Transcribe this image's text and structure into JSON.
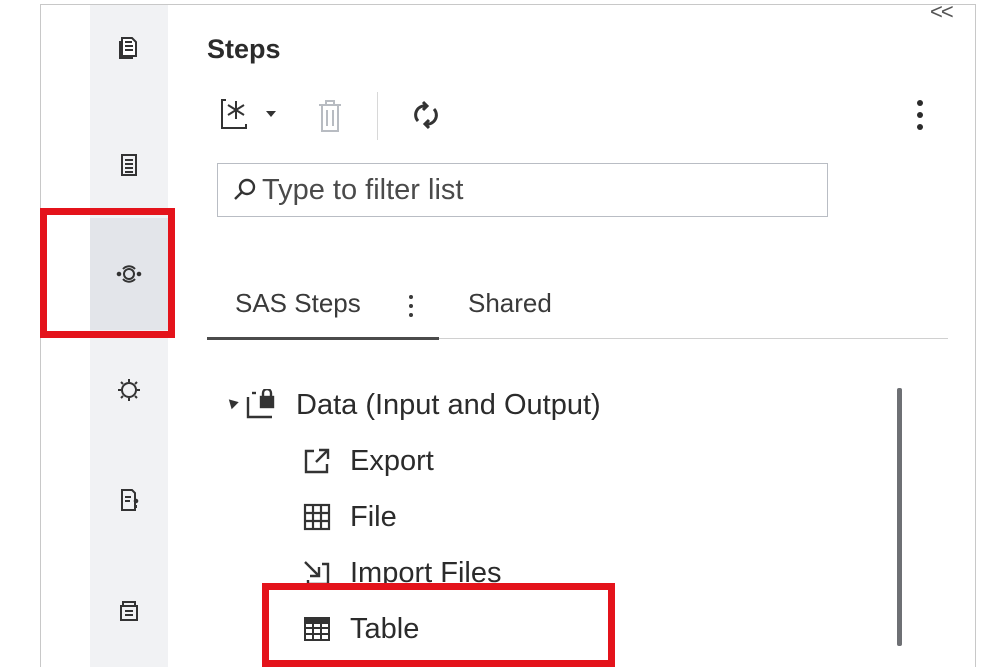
{
  "panel": {
    "title": "Steps",
    "collapse_glyph": "<<",
    "more_options_icon": "vertical-ellipsis-icon"
  },
  "toolbar": {
    "new_step_icon": "new-step-icon",
    "delete_icon": "trash-icon",
    "refresh_icon": "refresh-icon"
  },
  "search": {
    "placeholder": "Type to filter list",
    "icon": "search-icon"
  },
  "tabs": [
    {
      "label": "SAS Steps",
      "selected": true
    },
    {
      "label": "Shared",
      "selected": false
    }
  ],
  "tree": {
    "group_label": "Data (Input and Output)",
    "group_expanded": true,
    "items": [
      {
        "label": "Export",
        "icon": "export-icon"
      },
      {
        "label": "File",
        "icon": "grid-file-icon"
      },
      {
        "label": "Import Files",
        "icon": "import-icon"
      },
      {
        "label": "Table",
        "icon": "table-icon"
      }
    ]
  },
  "rail": {
    "items": [
      {
        "name": "documents",
        "icon": "documents-icon"
      },
      {
        "name": "libraries",
        "icon": "library-icon"
      },
      {
        "name": "steps",
        "icon": "steps-icon",
        "active": true
      },
      {
        "name": "settings",
        "icon": "settings-icon"
      },
      {
        "name": "snippets",
        "icon": "snippets-icon"
      },
      {
        "name": "content",
        "icon": "content-icon"
      }
    ]
  },
  "colors": {
    "highlight": "#e4131b",
    "rail_background": "#f1f2f4",
    "text": "#2b2b2b"
  }
}
